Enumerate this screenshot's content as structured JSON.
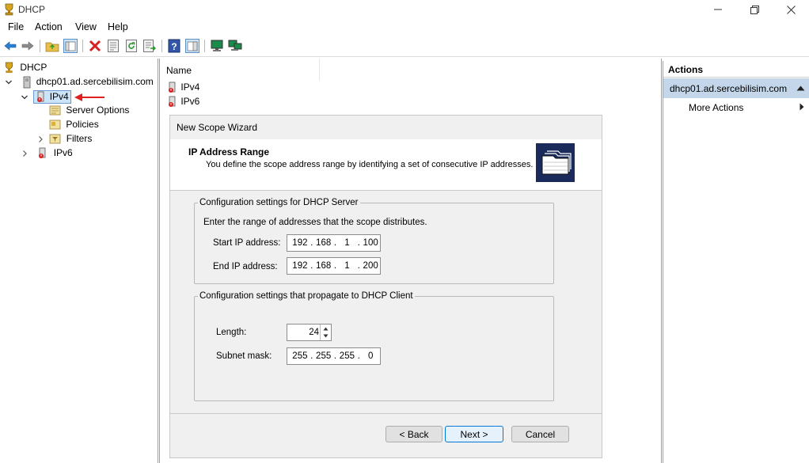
{
  "window": {
    "title": "DHCP"
  },
  "menu": [
    "File",
    "Action",
    "View",
    "Help"
  ],
  "tree": {
    "root": "DHCP",
    "server": "dhcp01.ad.sercebilisim.com",
    "ipv4": "IPv4",
    "server_options": "Server Options",
    "policies": "Policies",
    "filters": "Filters",
    "ipv6": "IPv6"
  },
  "center": {
    "column_name": "Name",
    "items": [
      "IPv4",
      "IPv6"
    ]
  },
  "wizard": {
    "title": "New Scope Wizard",
    "heading": "IP Address Range",
    "subheading": "You define the scope address range by identifying a set of consecutive IP addresses.",
    "server_group": {
      "label": "Configuration settings for DHCP Server",
      "instruction": "Enter the range of addresses that the scope distributes.",
      "start_label": "Start IP address:",
      "start_ip": [
        "192",
        "168",
        "1",
        "100"
      ],
      "end_label": "End IP address:",
      "end_ip": [
        "192",
        "168",
        "1",
        "200"
      ]
    },
    "client_group": {
      "label": "Configuration settings that propagate to DHCP Client",
      "length_label": "Length:",
      "length_value": "24",
      "mask_label": "Subnet mask:",
      "mask": [
        "255",
        "255",
        "255",
        "0"
      ]
    },
    "buttons": {
      "back": "< Back",
      "next": "Next >",
      "cancel": "Cancel"
    }
  },
  "actions": {
    "header": "Actions",
    "selected": "dhcp01.ad.sercebilisim.com",
    "more": "More Actions"
  }
}
